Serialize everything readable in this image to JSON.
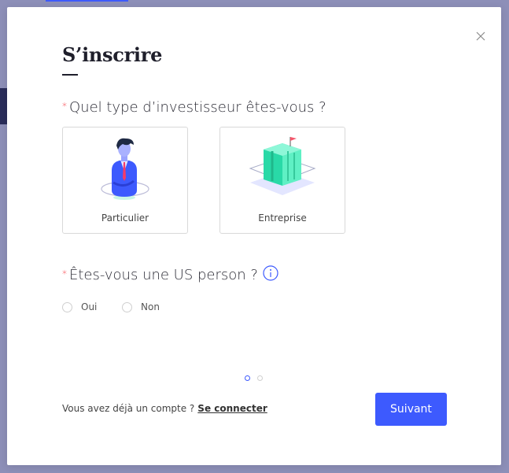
{
  "modal": {
    "title": "S’inscrire",
    "question_investor": "Quel type d’investisseur êtes-vous ?",
    "required_mark": "*",
    "options": [
      {
        "label": "Particulier"
      },
      {
        "label": "Entreprise"
      }
    ],
    "question_us": "Êtes-vous une US person ?",
    "radio": {
      "yes": "Oui",
      "no": "Non"
    },
    "steps": {
      "current": 1,
      "total": 2
    },
    "footer_text": "Vous avez déjà un compte ?",
    "login_link": "Se connecter",
    "next_button": "Suivant"
  },
  "colors": {
    "accent": "#3d5afe",
    "required": "#f5222d",
    "overlay": "#8d8fb8"
  },
  "icons": {
    "close": "close-icon",
    "info": "info-icon"
  }
}
